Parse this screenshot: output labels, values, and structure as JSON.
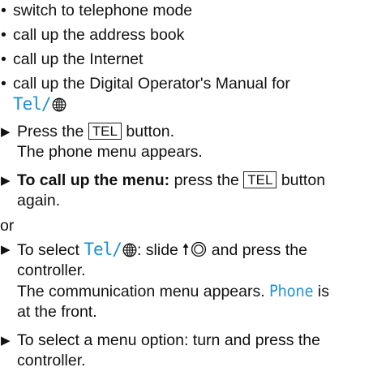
{
  "bullets": [
    "switch to telephone mode",
    "call up the address book",
    "call up the Internet",
    "call up the Digital Operator's Manual for"
  ],
  "tel_label": "Tel/",
  "icons": {
    "bullet": "bullet-dot",
    "step": "right-triangle-arrow",
    "globe": "globe-icon",
    "controller": "controller-slide-up-icon"
  },
  "steps": {
    "press_tel": {
      "pre": "Press the",
      "key": "TEL",
      "post": "button.",
      "result": "The phone menu appears."
    },
    "call_menu": {
      "bold": "To call up the menu:",
      "pre": "press the",
      "key": "TEL",
      "post": "button",
      "cont": "again."
    },
    "or": "or",
    "select_tel": {
      "pre": "To select",
      "mid": ": slide",
      "post": "and press the",
      "cont": "controller.",
      "result_pre": "The communication menu appears.",
      "result_blue": "Phone",
      "result_post": "is",
      "result_cont": "at the front."
    },
    "select_option": {
      "text": "To select a menu option: turn and press the",
      "cont": "controller."
    }
  },
  "colors": {
    "accent_blue": "#1a8fd6",
    "text": "#111111"
  }
}
